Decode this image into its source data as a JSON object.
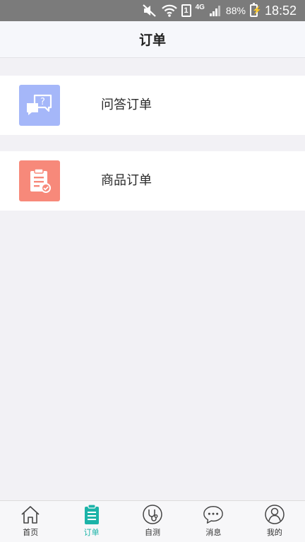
{
  "status_bar": {
    "sim_slot": "1",
    "network": "4G",
    "battery": "88%",
    "time": "18:52",
    "icons": [
      "mute-icon",
      "wifi-icon",
      "sim-icon",
      "signal-icon",
      "battery-charging-icon"
    ]
  },
  "header": {
    "title": "订单"
  },
  "orders": {
    "items": [
      {
        "label": "问答订单",
        "icon": "qa-chat-icon",
        "color": "#a5b7f9"
      },
      {
        "label": "商品订单",
        "icon": "clipboard-check-icon",
        "color": "#f7897a"
      }
    ]
  },
  "tabbar": {
    "active_color": "#1bb3a8",
    "tabs": [
      {
        "label": "首页",
        "icon": "home-icon"
      },
      {
        "label": "订单",
        "icon": "order-clipboard-icon",
        "active": true
      },
      {
        "label": "自测",
        "icon": "stethoscope-icon"
      },
      {
        "label": "消息",
        "icon": "message-bubble-icon"
      },
      {
        "label": "我的",
        "icon": "user-icon"
      }
    ]
  }
}
